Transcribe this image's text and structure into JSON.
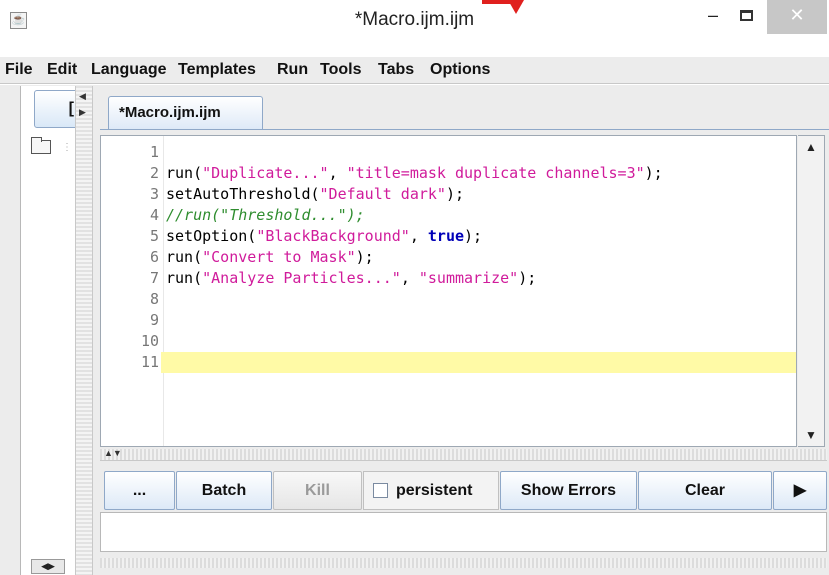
{
  "window": {
    "title": "*Macro.ijm.ijm",
    "minimize_glyph": "–",
    "close_glyph": "✕"
  },
  "menu": [
    {
      "label": "File"
    },
    {
      "label": "Edit"
    },
    {
      "label": "Language"
    },
    {
      "label": "Templates"
    },
    {
      "label": "Run"
    },
    {
      "label": "Tools"
    },
    {
      "label": "Tabs"
    },
    {
      "label": "Options"
    }
  ],
  "left_panel": {
    "button_label": "["
  },
  "editor": {
    "tab_label": "*Macro.ijm.ijm",
    "current_line": 11,
    "lines": [
      {
        "n": "1",
        "code": ""
      },
      {
        "n": "2",
        "code": "run(\"Duplicate...\", \"title=mask duplicate channels=3\");"
      },
      {
        "n": "3",
        "code": "setAutoThreshold(\"Default dark\");"
      },
      {
        "n": "4",
        "code": "//run(\"Threshold...\");"
      },
      {
        "n": "5",
        "code": "setOption(\"BlackBackground\", true);"
      },
      {
        "n": "6",
        "code": "run(\"Convert to Mask\");"
      },
      {
        "n": "7",
        "code": "run(\"Analyze Particles...\", \"summarize\");"
      },
      {
        "n": "8",
        "code": ""
      },
      {
        "n": "9",
        "code": ""
      },
      {
        "n": "10",
        "code": ""
      },
      {
        "n": "11",
        "code": ""
      }
    ]
  },
  "toolbar": {
    "more_label": "...",
    "batch_label": "Batch",
    "kill_label": "Kill",
    "persistent_label": "persistent",
    "persistent_checked": false,
    "show_errors_label": "Show Errors",
    "clear_label": "Clear",
    "next_glyph": "▶"
  },
  "icons": {
    "app": "java-cup-icon",
    "folder": "folder-icon",
    "scroll_up": "arrow-up-icon",
    "scroll_down": "arrow-down-icon"
  },
  "colors": {
    "string": "#d01b9b",
    "keyword": "#0000b8",
    "comment": "#2f8d2f",
    "current_line": "#fffaa6",
    "close_button": "#c7c7c7"
  }
}
